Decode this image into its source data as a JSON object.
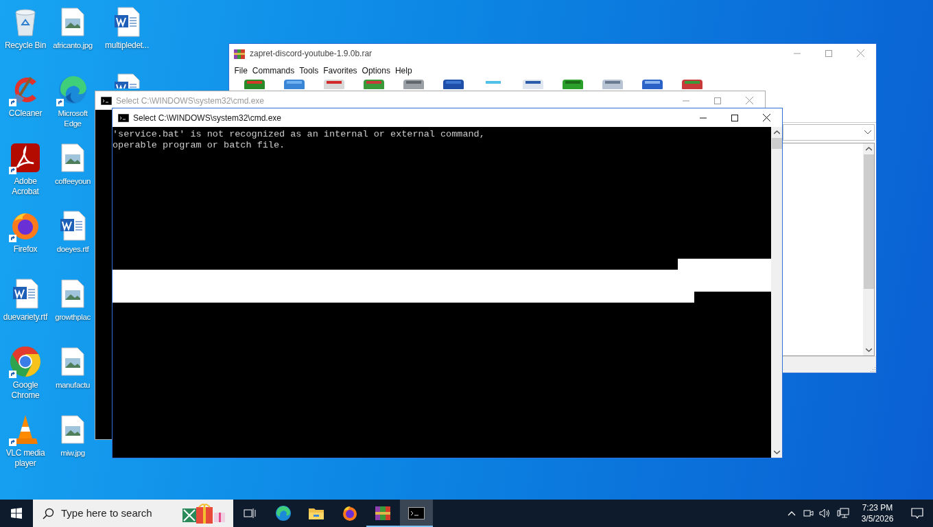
{
  "desktop_icons": [
    [
      {
        "label": "Recycle Bin",
        "kind": "recycle",
        "shortcut": false
      },
      {
        "label": "CCleaner",
        "kind": "ccleaner",
        "shortcut": true
      },
      {
        "label": "Adobe Acrobat",
        "kind": "acrobat",
        "shortcut": true
      },
      {
        "label": "Firefox",
        "kind": "firefox",
        "shortcut": true
      },
      {
        "label": "duevariety.rtf",
        "kind": "word",
        "shortcut": false
      },
      {
        "label": "Google Chrome",
        "kind": "chrome",
        "shortcut": true
      },
      {
        "label": "VLC media player",
        "kind": "vlc",
        "shortcut": true
      }
    ],
    [
      {
        "label": "africanto.jpg",
        "kind": "image",
        "shortcut": false
      },
      {
        "label": "Microsoft Edge",
        "kind": "edge",
        "shortcut": true
      },
      {
        "label": "coffeeyoun",
        "kind": "image",
        "shortcut": false
      },
      {
        "label": "doeyes.rtf",
        "kind": "word",
        "shortcut": false
      },
      {
        "label": "growthplac",
        "kind": "image",
        "shortcut": false
      },
      {
        "label": "manufactu",
        "kind": "image",
        "shortcut": false
      },
      {
        "label": "miw.jpg",
        "kind": "image",
        "shortcut": false
      }
    ],
    [
      {
        "label": "multipledet...",
        "kind": "word",
        "shortcut": false
      },
      {
        "kind": "word",
        "shortcut": false
      }
    ]
  ],
  "archive_window": {
    "title": "zapret-discord-youtube-1.9.0b.rar",
    "menu": [
      "File",
      "Commands",
      "Tools",
      "Favorites",
      "Options",
      "Help"
    ]
  },
  "console_back": {
    "title": "Select C:\\WINDOWS\\system32\\cmd.exe",
    "active": false
  },
  "console_front": {
    "title": "Select C:\\WINDOWS\\system32\\cmd.exe",
    "active": true,
    "lines": [
      "'service.bat' is not recognized as an internal or external command,",
      "operable program or batch file."
    ]
  },
  "taskbar": {
    "search": {
      "placeholder": "Type here to search"
    },
    "apps": [
      {
        "kind": "taskview",
        "running": false,
        "selected": false
      },
      {
        "kind": "edge",
        "running": false,
        "selected": false
      },
      {
        "kind": "explorer",
        "running": false,
        "selected": false
      },
      {
        "kind": "firefox",
        "running": false,
        "selected": false
      },
      {
        "kind": "archiver",
        "running": true,
        "selected": false
      },
      {
        "kind": "console",
        "running": true,
        "selected": true
      }
    ],
    "time": "7:23 PM",
    "date": "3/5/2026"
  }
}
